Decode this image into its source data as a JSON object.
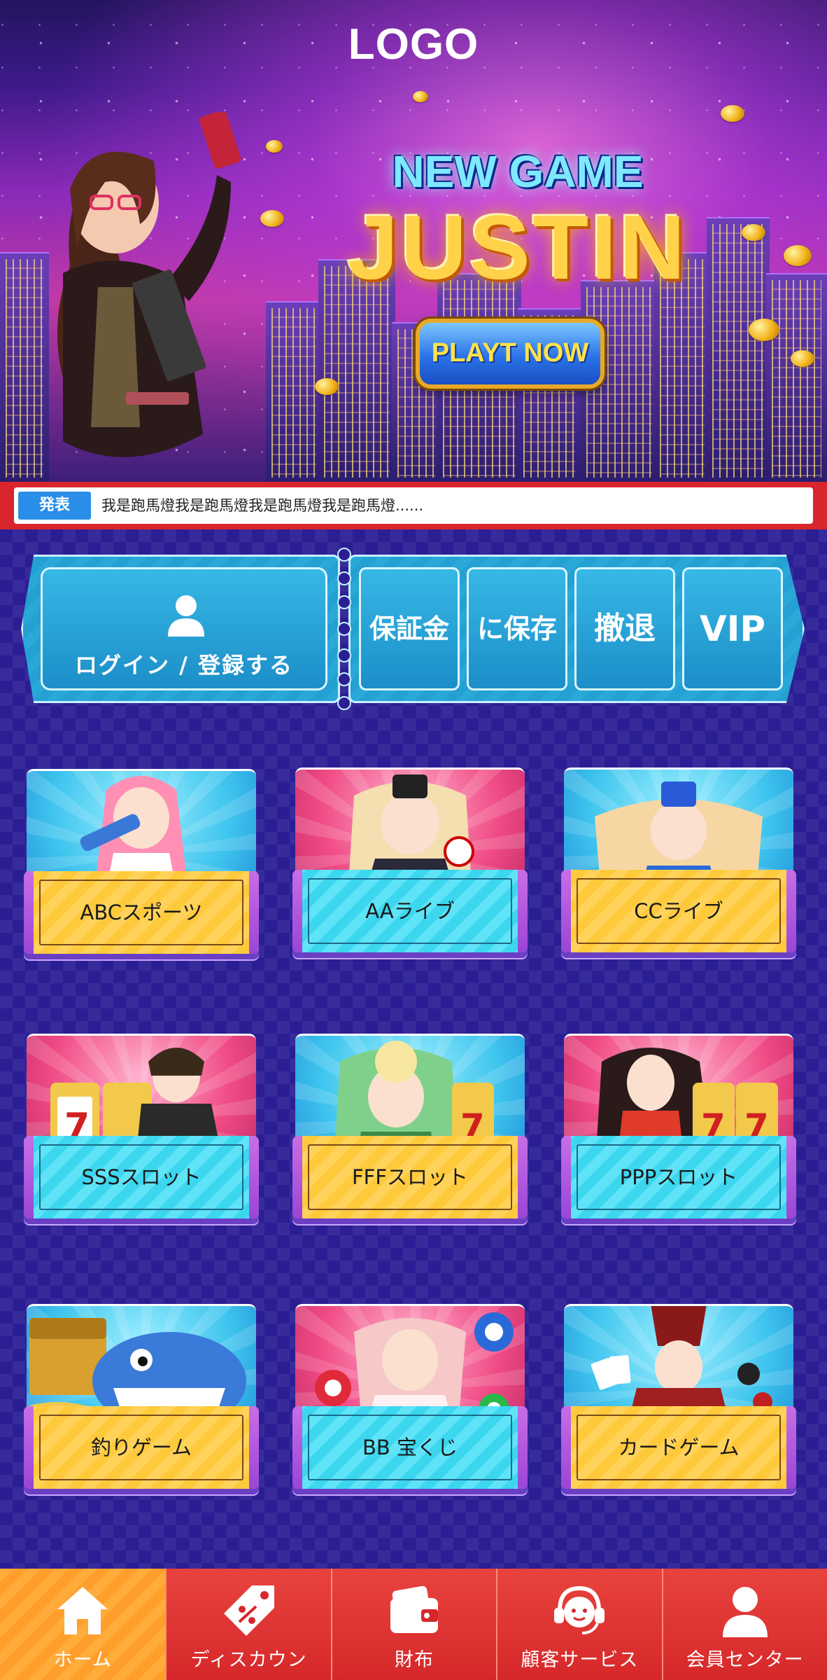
{
  "header": {
    "logo_text": "LOGO"
  },
  "banner": {
    "headline_small": "NEW GAME",
    "headline_big": "JUSTIN",
    "cta_label": "PLAYT NOW"
  },
  "notice": {
    "tag": "発表",
    "text": "我是跑馬燈我是跑馬燈我是跑馬燈我是跑馬燈......"
  },
  "account": {
    "login_label": "ログイン / 登録する",
    "actions": [
      {
        "label": "保証金"
      },
      {
        "label": "に保存"
      },
      {
        "label": "撤退"
      },
      {
        "label": "VIP"
      }
    ]
  },
  "games": [
    {
      "label": "ABCスポーツ",
      "theme": "cyan",
      "label_color": "yellow"
    },
    {
      "label": "AAライブ",
      "theme": "pink",
      "label_color": "cyan"
    },
    {
      "label": "CCライブ",
      "theme": "cyan",
      "label_color": "yellow"
    },
    {
      "label": "SSSスロット",
      "theme": "pink",
      "label_color": "cyan"
    },
    {
      "label": "FFFスロット",
      "theme": "cyan",
      "label_color": "yellow"
    },
    {
      "label": "PPPスロット",
      "theme": "pink",
      "label_color": "cyan"
    },
    {
      "label": "釣りゲーム",
      "theme": "cyan",
      "label_color": "yellow"
    },
    {
      "label": "BB 宝くじ",
      "theme": "pink",
      "label_color": "cyan"
    },
    {
      "label": "カードゲーム",
      "theme": "cyan",
      "label_color": "yellow"
    }
  ],
  "bottom_nav": [
    {
      "label": "ホーム",
      "icon": "home-icon",
      "active": true
    },
    {
      "label": "ディスカウン",
      "icon": "discount-tag-icon",
      "active": false
    },
    {
      "label": "財布",
      "icon": "wallet-icon",
      "active": false
    },
    {
      "label": "顧客サービス",
      "icon": "customer-service-icon",
      "active": false
    },
    {
      "label": "会員センター",
      "icon": "member-icon",
      "active": false
    }
  ],
  "colors": {
    "nav_red": "#d6282a",
    "nav_active": "#ffa232",
    "notice_tag": "#2a8ee8",
    "ticket_blue": "#2aa8d8",
    "page_bg": "#2b1e95"
  }
}
